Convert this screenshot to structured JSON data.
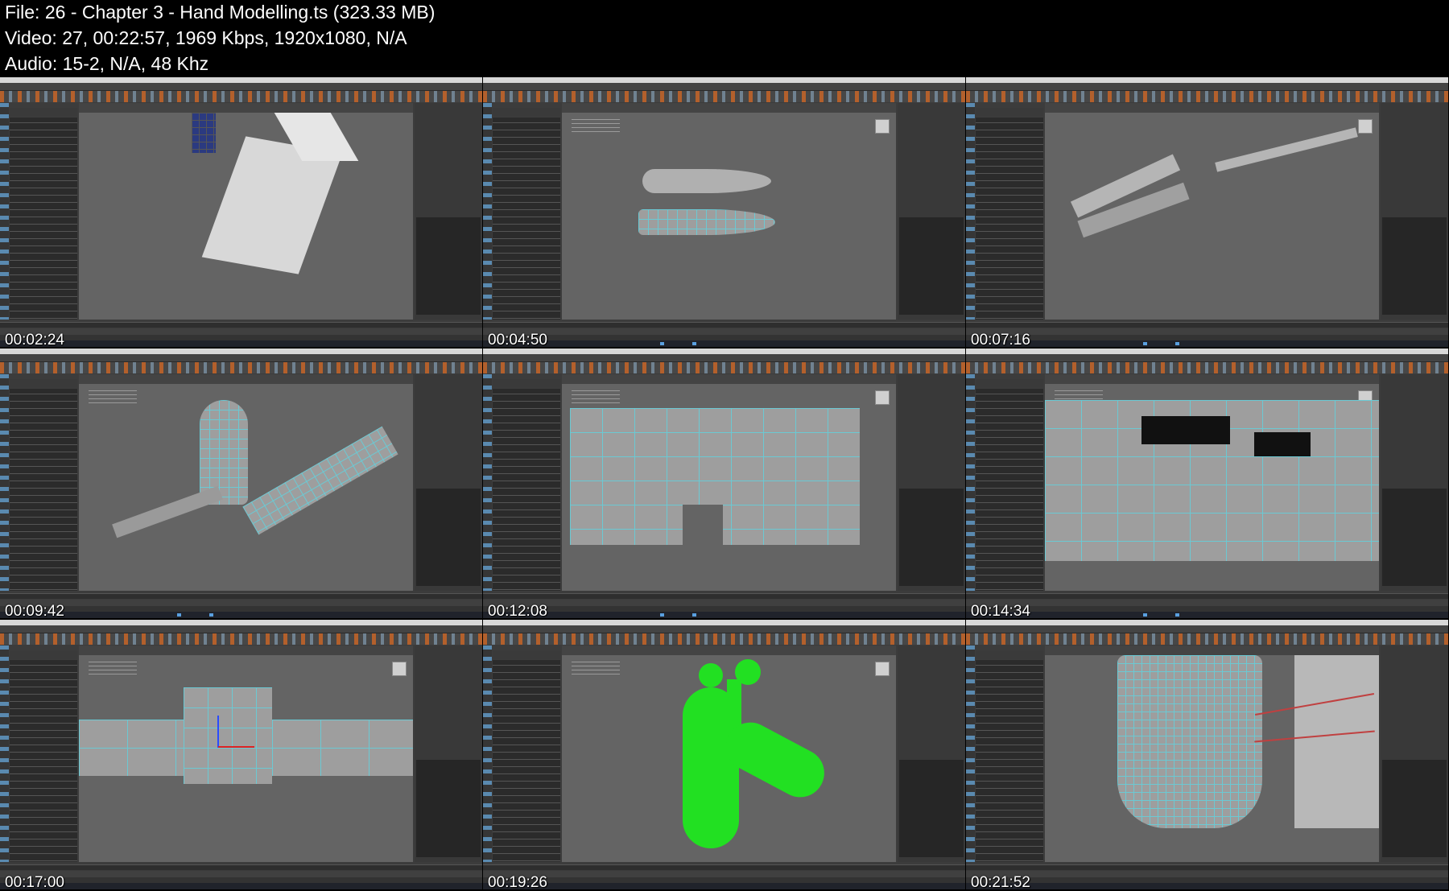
{
  "header": {
    "file_line": "File: 26 - Chapter 3 - Hand Modelling.ts (323.33 MB)",
    "video_line": "Video: 27, 00:22:57, 1969 Kbps, 1920x1080, N/A",
    "audio_line": "Audio: 15-2, N/A, 48 Khz"
  },
  "thumbnails": [
    {
      "timestamp": "00:02:24",
      "scene": "reference-image-planes"
    },
    {
      "timestamp": "00:04:50",
      "scene": "finger-cylinders"
    },
    {
      "timestamp": "00:07:16",
      "scene": "finger-claws"
    },
    {
      "timestamp": "00:09:42",
      "scene": "palm-knuckle-wireframe"
    },
    {
      "timestamp": "00:12:08",
      "scene": "palm-closeup"
    },
    {
      "timestamp": "00:14:34",
      "scene": "palm-bridge-faces"
    },
    {
      "timestamp": "00:17:00",
      "scene": "palm-move-gizmo"
    },
    {
      "timestamp": "00:19:26",
      "scene": "green-smooth-hand"
    },
    {
      "timestamp": "00:21:52",
      "scene": "wrist-dense-wireframe"
    }
  ]
}
